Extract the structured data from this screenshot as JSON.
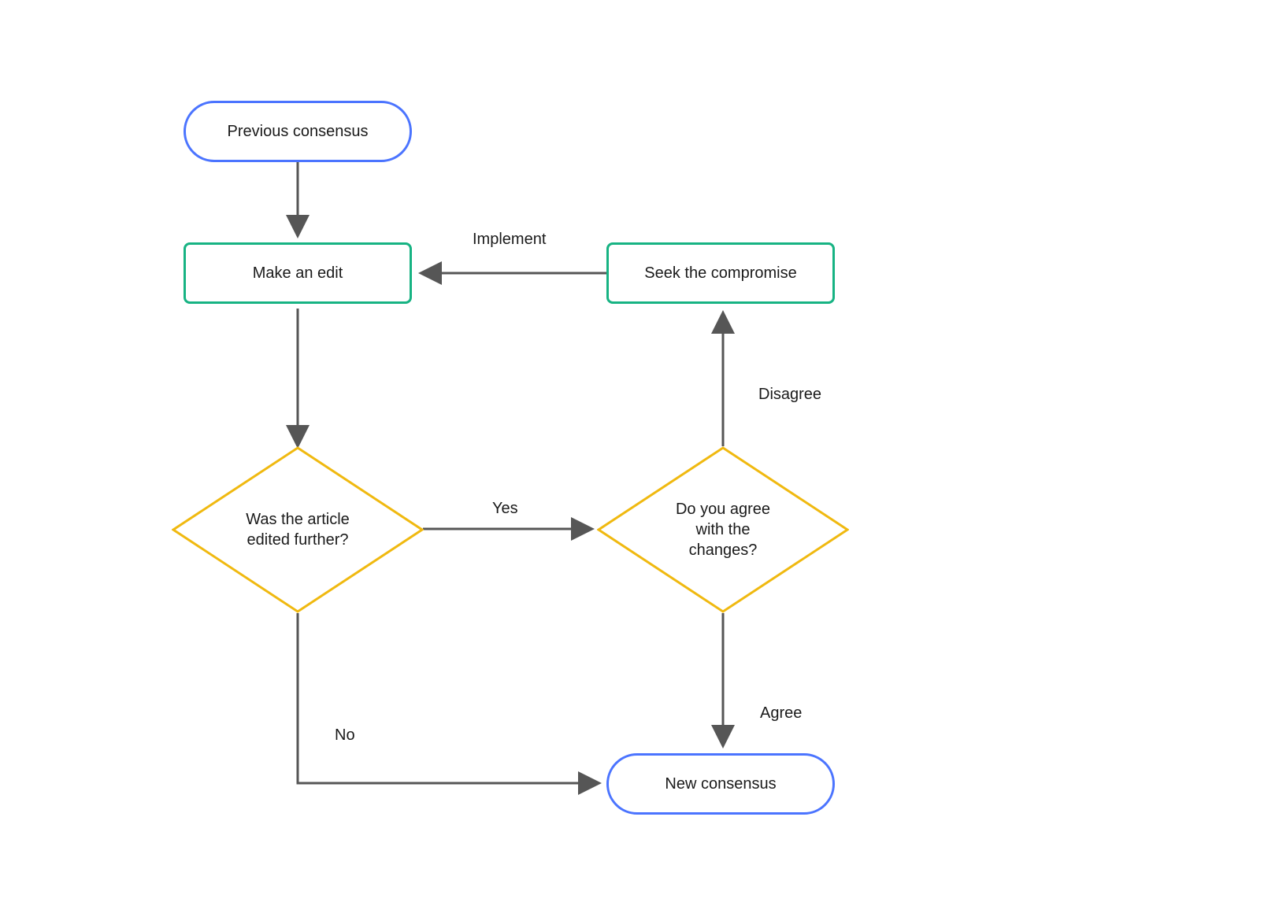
{
  "diagram": {
    "nodes": {
      "prev_consensus": {
        "label": "Previous consensus",
        "type": "terminal"
      },
      "make_edit": {
        "label": "Make an edit",
        "type": "process"
      },
      "seek_compromise": {
        "label": "Seek the compromise",
        "type": "process"
      },
      "edited_further": {
        "label": "Was the article\nedited further?",
        "type": "decision"
      },
      "agree_changes": {
        "label": "Do you agree\nwith the\nchanges?",
        "type": "decision"
      },
      "new_consensus": {
        "label": "New consensus",
        "type": "terminal"
      }
    },
    "edges": {
      "implement": {
        "label": "Implement"
      },
      "disagree": {
        "label": "Disagree"
      },
      "yes": {
        "label": "Yes"
      },
      "no": {
        "label": "No"
      },
      "agree": {
        "label": "Agree"
      }
    },
    "colors": {
      "terminal_border": "#4b74ff",
      "process_border": "#17b383",
      "decision_border": "#f0b910",
      "arrow": "#565656"
    }
  }
}
